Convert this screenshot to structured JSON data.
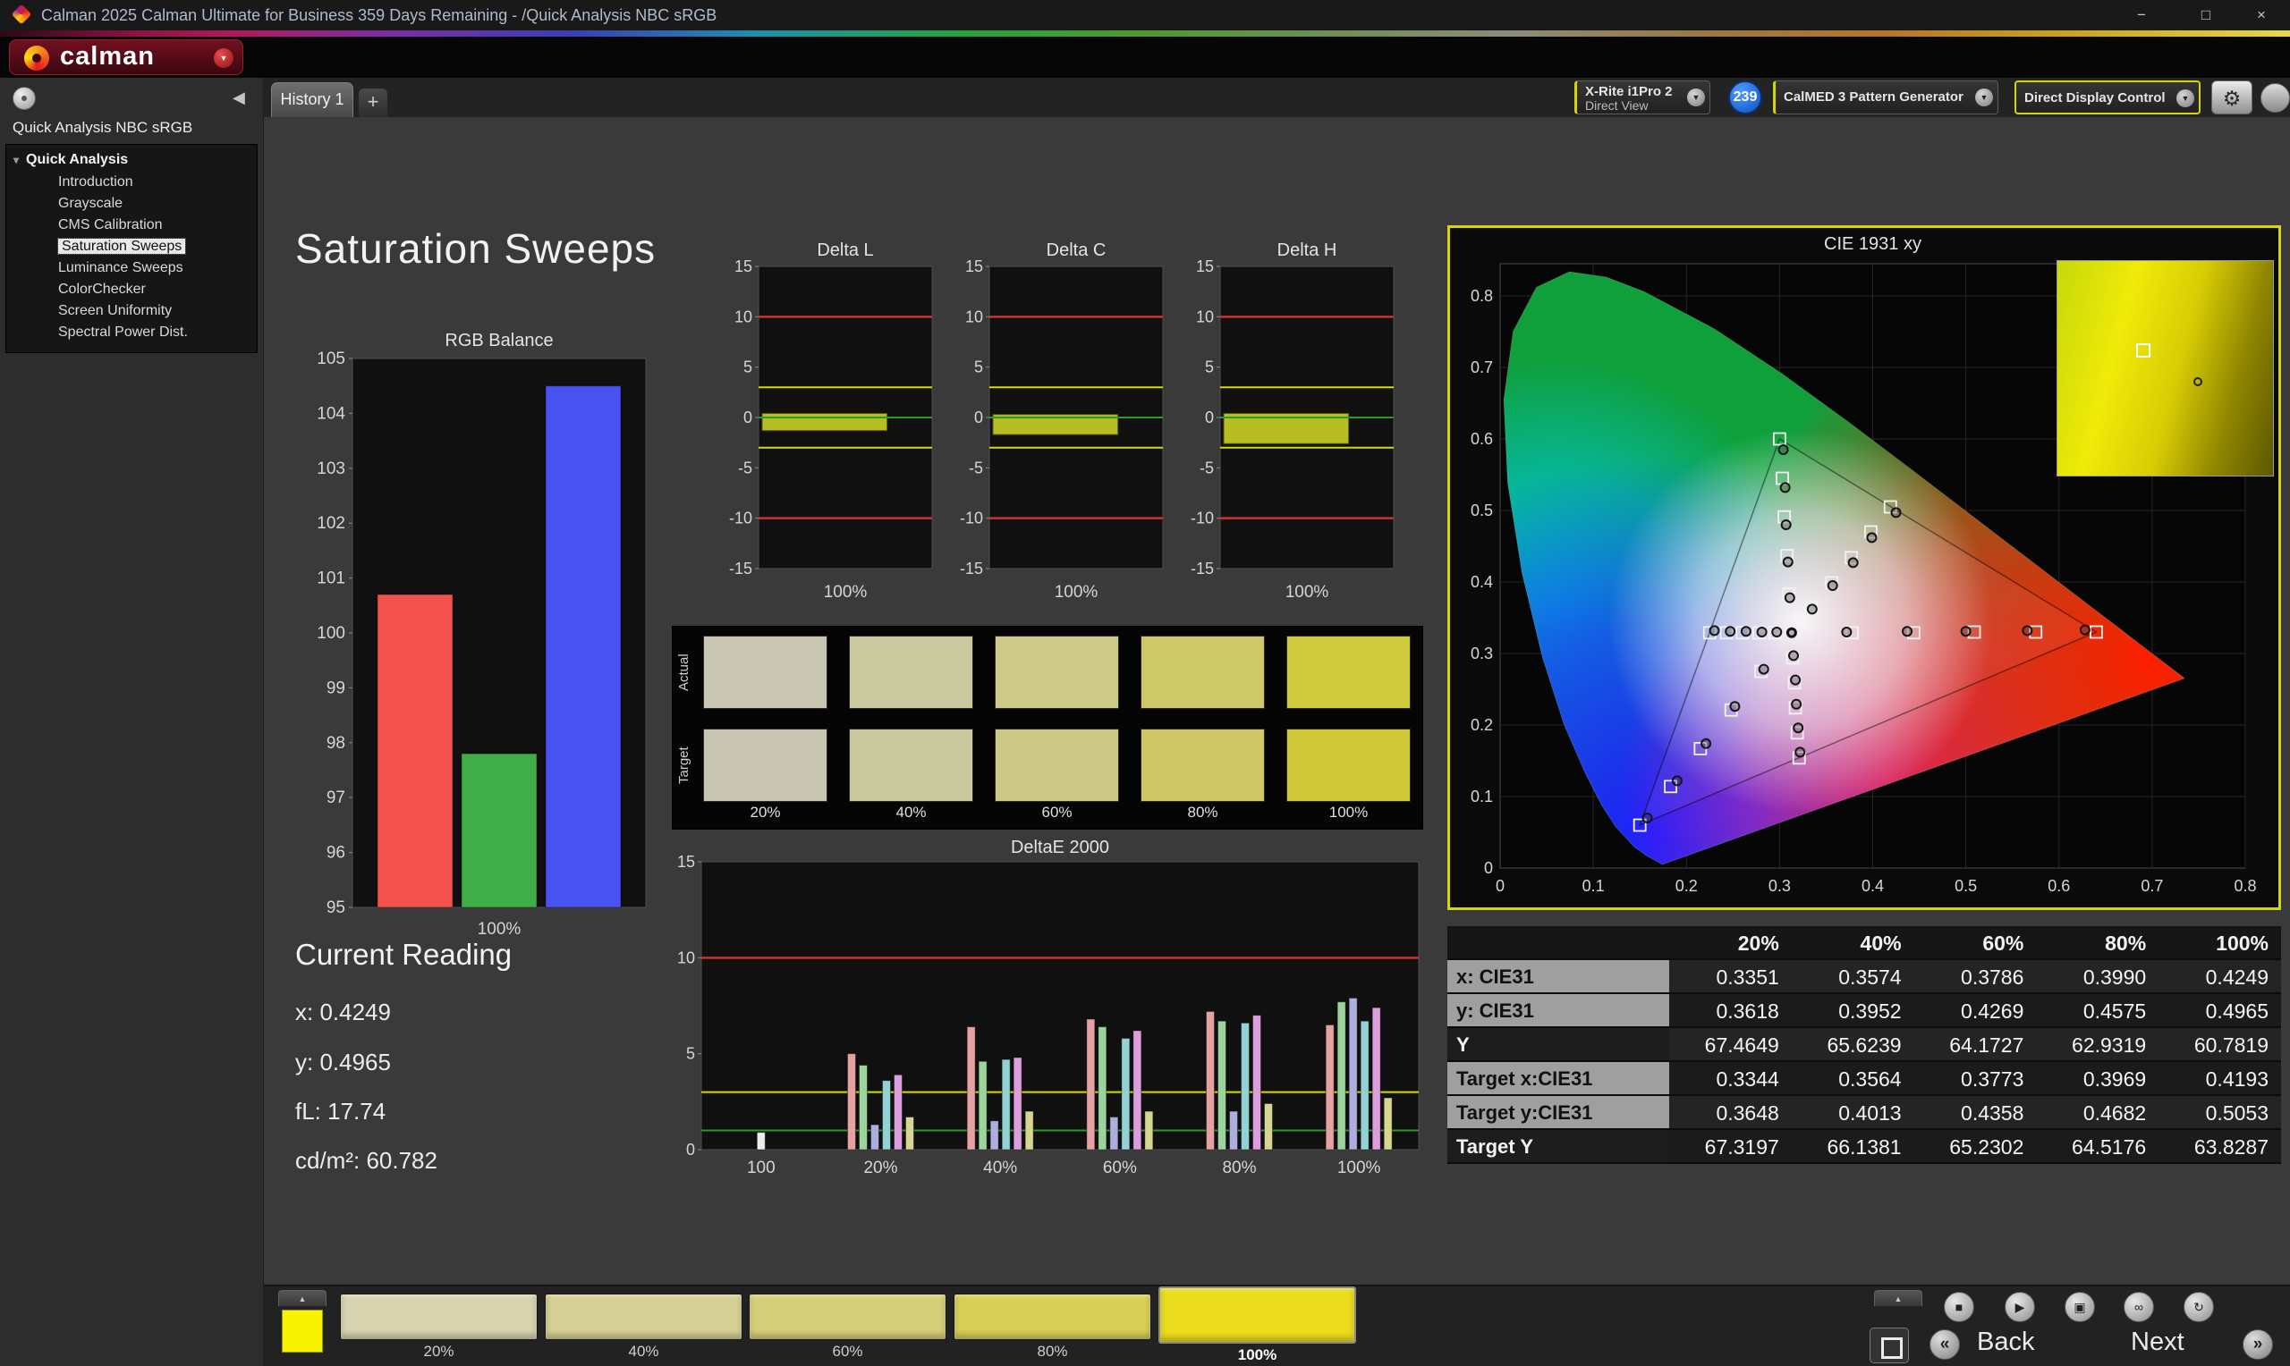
{
  "icons": {
    "minimize": "−",
    "maximize": "□",
    "close": "×",
    "dropdown": "▼",
    "collapse_left": "◀",
    "tab_up": "▲",
    "plus": "+",
    "tree_twisty": "▾",
    "stop": "■",
    "play": "▶",
    "save": "▣",
    "loop": "∞",
    "refresh": "↻",
    "gear": "⚙",
    "back_chevrons": "«",
    "next_chevrons": "»"
  },
  "colors": {
    "accent_yellow": "#d6d600",
    "limit_red": "#d03030",
    "limit_yellow": "#d8d800",
    "limit_green": "#2a9a2a",
    "badge_blue": "#0d4fc0"
  },
  "title_bar": {
    "title": "Calman 2025 Calman Ultimate for Business 359 Days Remaining  - /Quick Analysis NBC sRGB"
  },
  "header": {
    "logo_text": "calman"
  },
  "toolbar": {
    "tab": "History 1",
    "meter_line1": "X-Rite i1Pro 2",
    "meter_line2": "Direct View",
    "badge": "239",
    "pattern_generator": "CalMED 3 Pattern Generator",
    "display_control": "Direct Display Control"
  },
  "sidebar": {
    "workflow_title": "Quick Analysis NBC sRGB",
    "tree_root": "Quick Analysis",
    "items": [
      "Introduction",
      "Grayscale",
      "CMS Calibration",
      "Saturation Sweeps",
      "Luminance Sweeps",
      "ColorChecker",
      "Screen Uniformity",
      "Spectral Power Dist."
    ],
    "selected_item": "Saturation Sweeps"
  },
  "main": {
    "page_title": "Saturation Sweeps",
    "current_reading": {
      "title": "Current Reading",
      "lines": [
        "x: 0.4249",
        "y: 0.4965",
        "fL: 17.74",
        "cd/m²: 60.782"
      ]
    }
  },
  "swatch_panel": {
    "row_labels": [
      "Actual",
      "Target"
    ],
    "columns": [
      "20%",
      "40%",
      "60%",
      "80%",
      "100%"
    ],
    "actual_colors": [
      "#c9c7b4",
      "#cbc9a0",
      "#cdca89",
      "#cec968",
      "#d0ca3e"
    ],
    "target_colors": [
      "#c8c6b3",
      "#cac89e",
      "#ccc986",
      "#cdc865",
      "#cfc93a"
    ]
  },
  "chart_data": {
    "rgb_balance": {
      "type": "bar",
      "title": "RGB Balance",
      "categories": [
        "Red",
        "Green",
        "Blue"
      ],
      "values": [
        100.7,
        97.8,
        104.5
      ],
      "bar_colors": [
        "#f2514c",
        "#3fae49",
        "#4853f2"
      ],
      "ylim": [
        95,
        105
      ],
      "ytick_step": 1,
      "xlabel": "100%"
    },
    "delta_l": {
      "type": "bar",
      "title": "Delta L",
      "bar_range": [
        -1.3,
        0.4
      ],
      "ylim": [
        -15,
        15
      ],
      "ytick_step": 5,
      "xlabel": "100%",
      "limits": {
        "red": [
          -10,
          10
        ],
        "yellow": [
          -3,
          3
        ],
        "green": [
          0
        ]
      }
    },
    "delta_c": {
      "type": "bar",
      "title": "Delta C",
      "bar_range": [
        -1.7,
        0.3
      ],
      "ylim": [
        -15,
        15
      ],
      "ytick_step": 5,
      "xlabel": "100%",
      "limits": {
        "red": [
          -10,
          10
        ],
        "yellow": [
          -3,
          3
        ],
        "green": [
          0
        ]
      }
    },
    "delta_h": {
      "type": "bar",
      "title": "Delta H",
      "bar_range": [
        -2.6,
        0.4
      ],
      "ylim": [
        -15,
        15
      ],
      "ytick_step": 5,
      "xlabel": "100%",
      "limits": {
        "red": [
          -10,
          10
        ],
        "yellow": [
          -3,
          3
        ],
        "green": [
          0
        ]
      }
    },
    "delta_e_2000": {
      "type": "grouped-bar",
      "title": "DeltaE 2000",
      "categories": [
        "100",
        "20%",
        "40%",
        "60%",
        "80%",
        "100%"
      ],
      "groups": [
        [
          0.9
        ],
        [
          5.0,
          4.4,
          1.3,
          3.6,
          3.9,
          1.7
        ],
        [
          6.4,
          4.6,
          1.5,
          4.7,
          4.8,
          2.0
        ],
        [
          6.8,
          6.4,
          1.7,
          5.8,
          6.2,
          2.0
        ],
        [
          7.2,
          6.7,
          2.0,
          6.6,
          7.0,
          2.4
        ],
        [
          6.5,
          7.7,
          7.9,
          6.7,
          7.4,
          2.7
        ]
      ],
      "bar_colors": [
        "#e6a2a2",
        "#9dd49d",
        "#aeaede",
        "#92d2d2",
        "#dc9edc",
        "#d6d692"
      ],
      "single_bar_color": "#ececec",
      "ylim": [
        0,
        15
      ],
      "yticks": [
        0,
        5,
        10,
        15
      ],
      "lines": {
        "red": 10,
        "yellow": 3,
        "green": 1
      }
    },
    "cie_1931": {
      "type": "scatter",
      "title": "CIE 1931 xy",
      "xlim": [
        0,
        0.8
      ],
      "ylim": [
        0,
        0.845
      ],
      "tick_step": 0.1,
      "srgb_triangle": [
        [
          0.64,
          0.33
        ],
        [
          0.3,
          0.6
        ],
        [
          0.15,
          0.06
        ]
      ],
      "white_point": [
        0.313,
        0.329
      ],
      "targets": [
        [
          0.378,
          0.329
        ],
        [
          0.444,
          0.329
        ],
        [
          0.509,
          0.33
        ],
        [
          0.575,
          0.33
        ],
        [
          0.64,
          0.33
        ],
        [
          0.31,
          0.383
        ],
        [
          0.308,
          0.437
        ],
        [
          0.305,
          0.491
        ],
        [
          0.303,
          0.545
        ],
        [
          0.3,
          0.6
        ],
        [
          0.28,
          0.275
        ],
        [
          0.248,
          0.221
        ],
        [
          0.215,
          0.167
        ],
        [
          0.183,
          0.114
        ],
        [
          0.15,
          0.06
        ],
        [
          0.334,
          0.364
        ],
        [
          0.356,
          0.399
        ],
        [
          0.377,
          0.434
        ],
        [
          0.398,
          0.47
        ],
        [
          0.419,
          0.505
        ],
        [
          0.295,
          0.329
        ],
        [
          0.278,
          0.329
        ],
        [
          0.26,
          0.329
        ],
        [
          0.243,
          0.329
        ],
        [
          0.225,
          0.329
        ],
        [
          0.314,
          0.294
        ],
        [
          0.316,
          0.259
        ],
        [
          0.317,
          0.224
        ],
        [
          0.319,
          0.189
        ],
        [
          0.321,
          0.154
        ]
      ],
      "measurements": [
        [
          0.372,
          0.33
        ],
        [
          0.437,
          0.331
        ],
        [
          0.5,
          0.331
        ],
        [
          0.566,
          0.332
        ],
        [
          0.628,
          0.333
        ],
        [
          0.311,
          0.378
        ],
        [
          0.309,
          0.428
        ],
        [
          0.307,
          0.48
        ],
        [
          0.306,
          0.532
        ],
        [
          0.304,
          0.585
        ],
        [
          0.283,
          0.278
        ],
        [
          0.252,
          0.226
        ],
        [
          0.221,
          0.174
        ],
        [
          0.19,
          0.122
        ],
        [
          0.158,
          0.07
        ],
        [
          0.335,
          0.362
        ],
        [
          0.357,
          0.395
        ],
        [
          0.379,
          0.427
        ],
        [
          0.399,
          0.462
        ],
        [
          0.425,
          0.497
        ],
        [
          0.297,
          0.33
        ],
        [
          0.281,
          0.33
        ],
        [
          0.264,
          0.331
        ],
        [
          0.247,
          0.331
        ],
        [
          0.23,
          0.332
        ],
        [
          0.315,
          0.297
        ],
        [
          0.317,
          0.263
        ],
        [
          0.318,
          0.229
        ],
        [
          0.32,
          0.196
        ],
        [
          0.322,
          0.162
        ],
        [
          0.313,
          0.329
        ]
      ]
    }
  },
  "table": {
    "columns": [
      "20%",
      "40%",
      "60%",
      "80%",
      "100%"
    ],
    "rows": [
      {
        "label": "x: CIE31",
        "values": [
          "0.3351",
          "0.3574",
          "0.3786",
          "0.3990",
          "0.4249"
        ]
      },
      {
        "label": "y: CIE31",
        "values": [
          "0.3618",
          "0.3952",
          "0.4269",
          "0.4575",
          "0.4965"
        ]
      },
      {
        "label": "Y",
        "values": [
          "67.4649",
          "65.6239",
          "64.1727",
          "62.9319",
          "60.7819"
        ]
      },
      {
        "label": "Target x:CIE31",
        "values": [
          "0.3344",
          "0.3564",
          "0.3773",
          "0.3969",
          "0.4193"
        ]
      },
      {
        "label": "Target y:CIE31",
        "values": [
          "0.3648",
          "0.4013",
          "0.4358",
          "0.4682",
          "0.5053"
        ]
      },
      {
        "label": "Target Y",
        "values": [
          "67.3197",
          "66.1381",
          "65.2302",
          "64.5176",
          "63.8287"
        ]
      }
    ]
  },
  "bottom_bar": {
    "preview_color": "#f8f400",
    "swatches": [
      {
        "label": "20%",
        "color": "#d8d4b0"
      },
      {
        "label": "40%",
        "color": "#d7d096"
      },
      {
        "label": "60%",
        "color": "#d6cf7a"
      },
      {
        "label": "80%",
        "color": "#d8cf56"
      },
      {
        "label": "100%",
        "color": "#ecdc1e"
      }
    ],
    "selected": "100%",
    "back": "Back",
    "next": "Next"
  }
}
